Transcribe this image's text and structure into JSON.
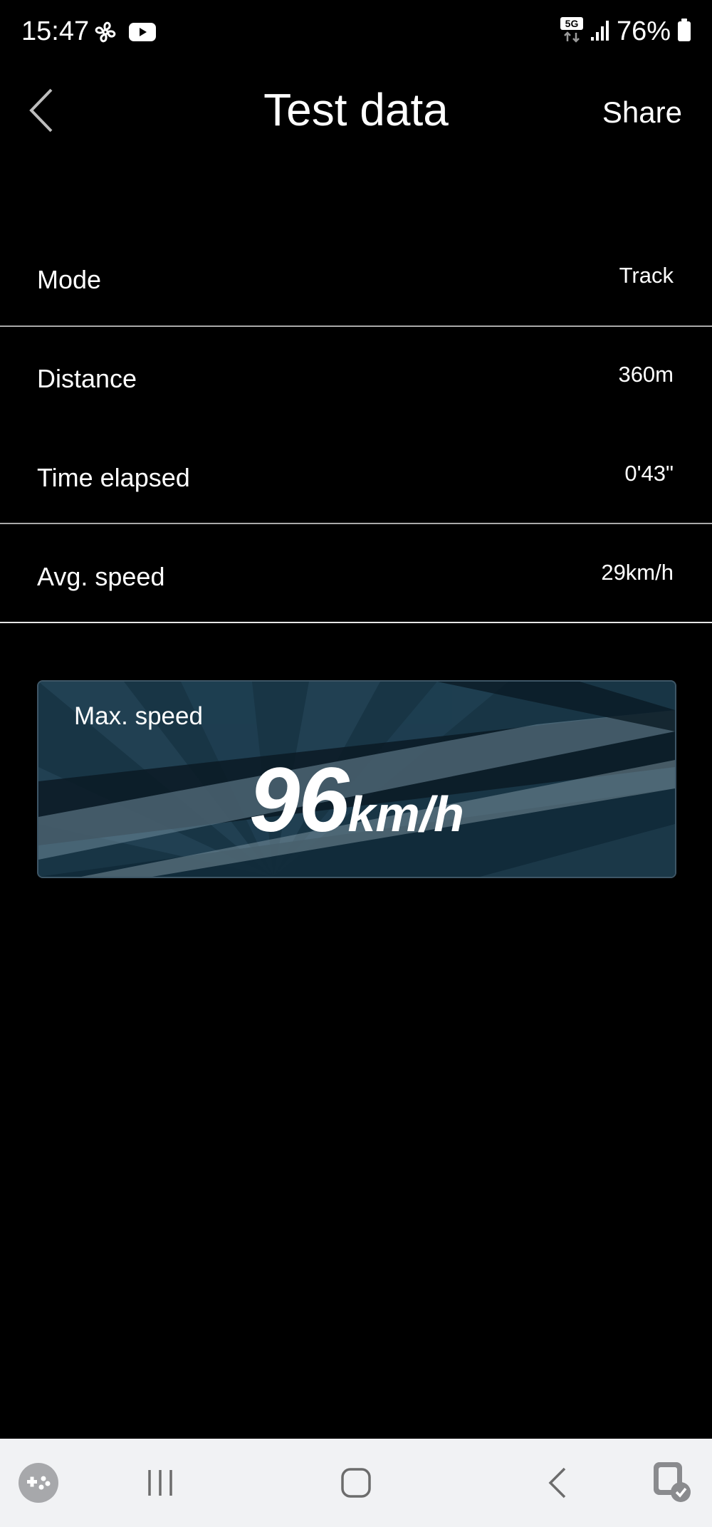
{
  "status_bar": {
    "time": "15:47",
    "battery": "76%",
    "network": "5G",
    "icons": [
      "fan-icon",
      "youtube-icon",
      "5g-icon",
      "signal-icon",
      "battery-icon"
    ]
  },
  "header": {
    "title": "Test data",
    "share_label": "Share",
    "back_icon": "chevron-left-icon"
  },
  "rows": [
    {
      "label": "Mode",
      "value": "Track"
    },
    {
      "label": "Distance",
      "value": "360m"
    },
    {
      "label": "Time elapsed",
      "value": "0'43\""
    },
    {
      "label": "Avg. speed",
      "value": "29km/h"
    }
  ],
  "max_speed": {
    "label": "Max. speed",
    "value": "96",
    "unit": "km/h"
  },
  "nav_bar": {
    "items": [
      "game-launcher-icon",
      "recent-apps-icon",
      "home-icon",
      "back-icon",
      "assistant-icon"
    ]
  },
  "colors": {
    "background": "#000000",
    "text": "#ffffff",
    "divider": "#a9a9a9",
    "card": "#143040",
    "nav_bar": "#f1f2f4"
  }
}
